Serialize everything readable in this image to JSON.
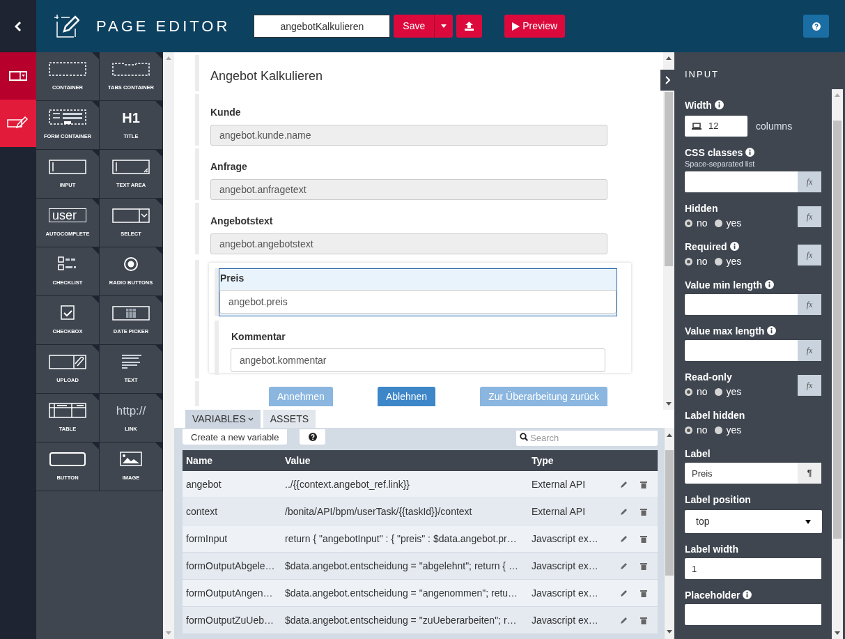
{
  "header": {
    "title": "PAGE EDITOR",
    "page_name": "angebotKalkulieren",
    "save": "Save",
    "preview": "Preview"
  },
  "rail": [
    {
      "kind": "layout",
      "selected": false
    },
    {
      "kind": "edit",
      "selected": true
    }
  ],
  "palette_rows": [
    [
      {
        "kind": "container",
        "label": "CONTAINER"
      },
      {
        "kind": "tabs",
        "label": "TABS CONTAINER"
      }
    ],
    [
      {
        "kind": "form",
        "label": "FORM CONTAINER"
      },
      {
        "kind": "title",
        "label": "TITLE",
        "glyph": "H1"
      }
    ],
    [
      {
        "kind": "input",
        "label": "INPUT"
      },
      {
        "kind": "textarea",
        "label": "TEXT AREA"
      }
    ],
    [
      {
        "kind": "autocomplete",
        "label": "AUTOCOMPLETE",
        "glyph": "user"
      },
      {
        "kind": "select",
        "label": "SELECT"
      }
    ],
    [
      {
        "kind": "checklist",
        "label": "CHECKLIST"
      },
      {
        "kind": "radio",
        "label": "RADIO BUTTONS"
      }
    ],
    [
      {
        "kind": "checkbox",
        "label": "CHECKBOX"
      },
      {
        "kind": "date",
        "label": "DATE PICKER"
      }
    ],
    [
      {
        "kind": "upload",
        "label": "UPLOAD"
      },
      {
        "kind": "text",
        "label": "TEXT"
      }
    ],
    [
      {
        "kind": "table",
        "label": "TABLE"
      },
      {
        "kind": "link",
        "label": "LINK",
        "glyph": "http://"
      }
    ],
    [
      {
        "kind": "button",
        "label": "BUTTON"
      },
      {
        "kind": "image",
        "label": "IMAGE"
      }
    ]
  ],
  "canvas": {
    "title": "Angebot Kalkulieren",
    "fields": [
      {
        "label": "Kunde",
        "value": "angebot.kunde.name",
        "readonly": true
      },
      {
        "label": "Anfrage",
        "value": "angebot.anfragetext",
        "readonly": true
      },
      {
        "label": "Angebotstext",
        "value": "angebot.angebotstext",
        "readonly": true
      }
    ],
    "group": [
      {
        "label": "Preis",
        "value": "angebot.preis",
        "selected": true
      },
      {
        "label": "Kommentar",
        "value": "angebot.kommentar",
        "selected": false
      }
    ],
    "buttons": [
      {
        "label": "Annehmen",
        "disabled": true
      },
      {
        "label": "Ablehnen",
        "disabled": false
      },
      {
        "label": "Zur Überarbeitung zurück",
        "disabled": true
      }
    ]
  },
  "bottom": {
    "tabs": [
      {
        "label": "VARIABLES",
        "selected": true
      },
      {
        "label": "ASSETS",
        "selected": false
      }
    ],
    "create": "Create a new variable",
    "search": {
      "placeholder": "Search"
    },
    "columns": [
      "Name",
      "Value",
      "Type"
    ],
    "rows": [
      {
        "name": "angebot",
        "value": "../{{context.angebot_ref.link}}",
        "type": "External API"
      },
      {
        "name": "context",
        "value": "/bonita/API/bpm/userTask/{{taskId}}/context",
        "type": "External API"
      },
      {
        "name": "formInput",
        "value": "return { \"angebotInput\" : { \"preis\" : $data.angebot.pr…",
        "type": "Javascript ex…"
      },
      {
        "name": "formOutputAbgele…",
        "value": "$data.angebot.entscheidung = \"abgelehnt\"; return { …",
        "type": "Javascript ex…"
      },
      {
        "name": "formOutputAngen…",
        "value": "$data.angebot.entscheidung = \"angenommen\"; retu…",
        "type": "Javascript ex…"
      },
      {
        "name": "formOutputZuUeb…",
        "value": "$data.angebot.entscheidung = \"zuUeberarbeiten\"; r…",
        "type": "Javascript ex…"
      }
    ]
  },
  "properties": {
    "title": "INPUT",
    "items": [
      {
        "kind": "width",
        "label": "Width",
        "info": true,
        "value": "12",
        "unit": "columns"
      },
      {
        "kind": "text",
        "label": "CSS classes",
        "info": true,
        "hint": "Space-separated list",
        "side": "fx"
      },
      {
        "kind": "radio",
        "label": "Hidden",
        "info": false,
        "options": [
          {
            "label": "no",
            "selected": true
          },
          {
            "label": "yes",
            "selected": false
          }
        ],
        "side": "fx"
      },
      {
        "kind": "radio",
        "label": "Required",
        "info": true,
        "options": [
          {
            "label": "no",
            "selected": true
          },
          {
            "label": "yes",
            "selected": false
          }
        ],
        "side": "fx"
      },
      {
        "kind": "text",
        "label": "Value min length",
        "info": true,
        "side": "fx"
      },
      {
        "kind": "text",
        "label": "Value max length",
        "info": true,
        "side": "fx"
      },
      {
        "kind": "radio",
        "label": "Read-only",
        "info": false,
        "options": [
          {
            "label": "no",
            "selected": true
          },
          {
            "label": "yes",
            "selected": false
          }
        ],
        "side": "fx"
      },
      {
        "kind": "radio",
        "label": "Label hidden",
        "info": false,
        "options": [
          {
            "label": "no",
            "selected": true
          },
          {
            "label": "yes",
            "selected": false
          }
        ]
      },
      {
        "kind": "text",
        "label": "Label",
        "info": false,
        "value": "Preis",
        "side": "¶"
      },
      {
        "kind": "select",
        "label": "Label position",
        "info": false,
        "value": "top"
      },
      {
        "kind": "text",
        "label": "Label width",
        "info": false,
        "value": "1"
      },
      {
        "kind": "text",
        "label": "Placeholder",
        "info": true
      }
    ]
  }
}
